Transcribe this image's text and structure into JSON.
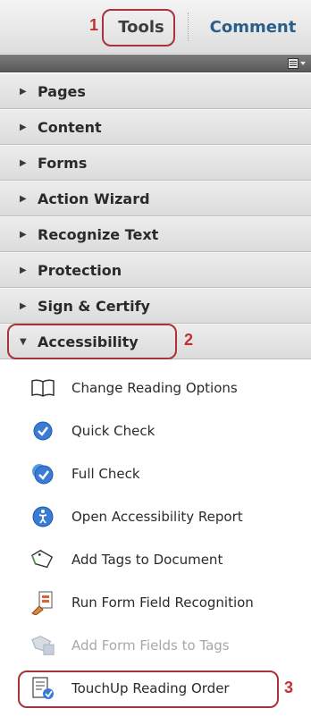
{
  "tabs": {
    "tools_label": "Tools",
    "comment_label": "Comment",
    "tools_callout": "1"
  },
  "panels": [
    {
      "label": "Pages",
      "expanded": false
    },
    {
      "label": "Content",
      "expanded": false
    },
    {
      "label": "Forms",
      "expanded": false
    },
    {
      "label": "Action Wizard",
      "expanded": false
    },
    {
      "label": "Recognize Text",
      "expanded": false
    },
    {
      "label": "Protection",
      "expanded": false
    },
    {
      "label": "Sign & Certify",
      "expanded": false
    },
    {
      "label": "Accessibility",
      "expanded": true
    }
  ],
  "accessibility_callout": "2",
  "accessibility_items": [
    {
      "label": "Change Reading Options",
      "icon": "book-icon",
      "enabled": true
    },
    {
      "label": "Quick Check",
      "icon": "check-circle-icon",
      "enabled": true
    },
    {
      "label": "Full Check",
      "icon": "full-check-icon",
      "enabled": true
    },
    {
      "label": "Open Accessibility Report",
      "icon": "accessibility-report-icon",
      "enabled": true
    },
    {
      "label": "Add Tags to Document",
      "icon": "add-tags-icon",
      "enabled": true
    },
    {
      "label": "Run Form Field Recognition",
      "icon": "form-field-recognition-icon",
      "enabled": true
    },
    {
      "label": "Add Form Fields to Tags",
      "icon": "form-fields-tags-icon",
      "enabled": false
    },
    {
      "label": "TouchUp Reading Order",
      "icon": "touchup-reading-order-icon",
      "enabled": true
    }
  ],
  "touchup_callout": "3",
  "colors": {
    "callout": "#a8333a",
    "comment_tab": "#2b5f8a",
    "icon_blue": "#3a7bd5"
  }
}
